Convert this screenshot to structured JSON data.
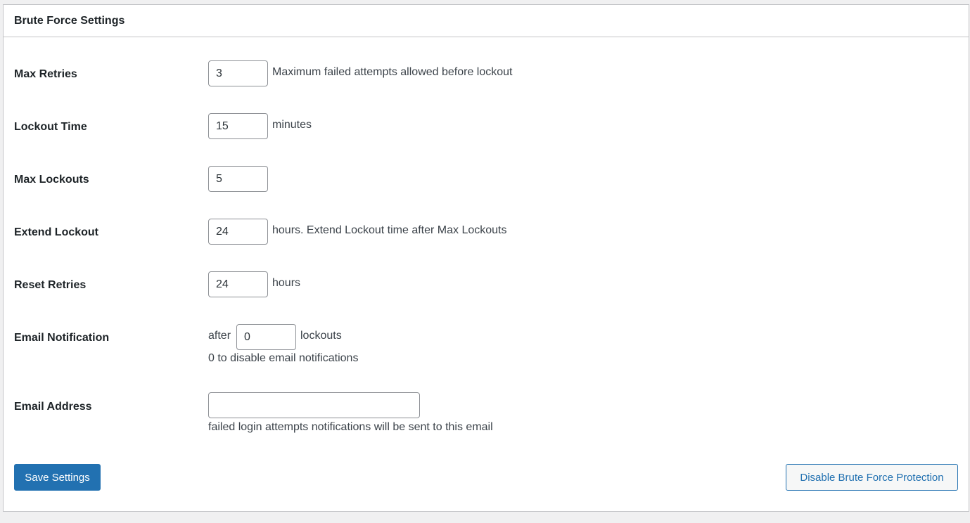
{
  "title": "Brute Force Settings",
  "rows": [
    {
      "label": "Max Retries",
      "value": "3",
      "hint": "Maximum failed attempts allowed before lockout"
    },
    {
      "label": "Lockout Time",
      "value": "15",
      "hint": "minutes"
    },
    {
      "label": "Max Lockouts",
      "value": "5"
    },
    {
      "label": "Extend Lockout",
      "value": "24",
      "hint": "hours. Extend Lockout time after Max Lockouts"
    },
    {
      "label": "Reset Retries",
      "value": "24",
      "hint": "hours"
    }
  ],
  "email_notification": {
    "label": "Email Notification",
    "prefix": "after",
    "value": "0",
    "suffix": "lockouts",
    "note": "0 to disable email notifications"
  },
  "email_address": {
    "label": "Email Address",
    "value": "",
    "note": "failed login attempts notifications will be sent to this email"
  },
  "buttons": {
    "save": "Save Settings",
    "disable": "Disable Brute Force Protection"
  }
}
